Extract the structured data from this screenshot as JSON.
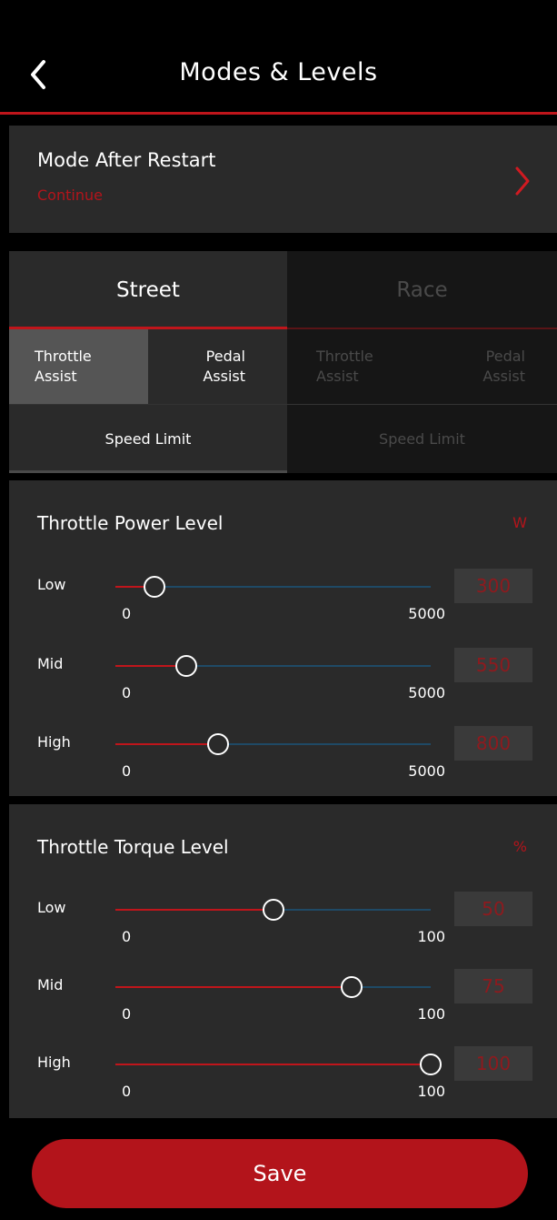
{
  "header": {
    "title": "Modes & Levels"
  },
  "mode_after_restart": {
    "title": "Mode After Restart",
    "value": "Continue"
  },
  "tabs": [
    {
      "label": "Street",
      "active": true
    },
    {
      "label": "Race",
      "active": false
    }
  ],
  "subtabs": {
    "street": {
      "throttle": "Throttle\nAssist",
      "pedal": "Pedal\nAssist",
      "speed": "Speed Limit"
    },
    "race": {
      "throttle": "Throttle\nAssist",
      "pedal": "Pedal\nAssist",
      "speed": "Speed Limit"
    }
  },
  "power": {
    "title": "Throttle Power Level",
    "unit": "W",
    "min": 0,
    "max": 5000,
    "min_label": "0",
    "max_label": "5000",
    "levels": [
      {
        "label": "Low",
        "value": "300",
        "fraction": 0.125
      },
      {
        "label": "Mid",
        "value": "550",
        "fraction": 0.225
      },
      {
        "label": "High",
        "value": "800",
        "fraction": 0.325
      }
    ]
  },
  "torque": {
    "title": "Throttle Torque Level",
    "unit": "%",
    "min": 0,
    "max": 100,
    "min_label": "0",
    "max_label": "100",
    "levels": [
      {
        "label": "Low",
        "value": "50",
        "fraction": 0.5
      },
      {
        "label": "Mid",
        "value": "75",
        "fraction": 0.75
      },
      {
        "label": "High",
        "value": "100",
        "fraction": 1.0
      }
    ]
  },
  "save_label": "Save",
  "colors": {
    "accent": "#c0151b",
    "track": "#1f4a66",
    "panel": "#2a2a2a",
    "background": "#000000"
  },
  "icons": {
    "back": "chevron-left-icon",
    "mode": "chevron-right-icon"
  }
}
